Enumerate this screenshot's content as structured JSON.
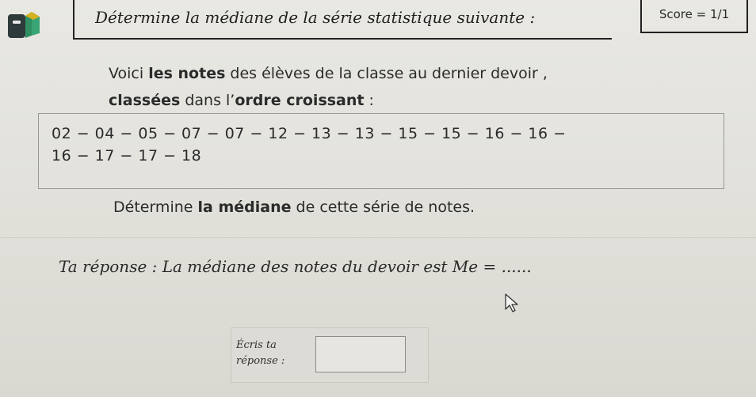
{
  "header": {
    "title": "Détermine la médiane de la série statistique suivante :",
    "score": "Score = 1/1"
  },
  "intro": {
    "line1_a": "Voici ",
    "line1_b": "les notes",
    "line1_c": " des élèves de la classe au dernier devoir ,",
    "line2_a": "classées",
    "line2_b": " dans l’",
    "line2_c": "ordre croissant",
    "line2_d": " :"
  },
  "series": {
    "line1": "02 − 04 − 05 − 07 − 07 − 12 − 13 − 13 − 15 − 15 − 16 − 16 −",
    "line2": "16 − 17 − 17 − 18"
  },
  "question": {
    "a": "Détermine ",
    "b": "la médiane",
    "c": " de cette série de notes."
  },
  "answer": {
    "sentence": "Ta réponse : La médiane des notes du devoir est Me = ......",
    "label": "Écris ta réponse :",
    "value": ""
  },
  "icons": {
    "app": "backpack-icon",
    "cursor": "mouse-pointer-icon"
  },
  "colors": {
    "background": "#e3e2dc",
    "app_icon_body": "#2f8f63",
    "app_icon_top": "#d6b21f"
  }
}
